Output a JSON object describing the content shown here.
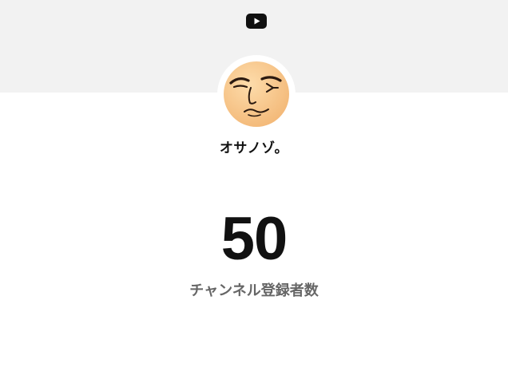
{
  "channel": {
    "name": "オサノゾ。",
    "avatar_icon": "smirking-face-avatar"
  },
  "header": {
    "logo_icon": "youtube-icon"
  },
  "subscribers": {
    "count": "50",
    "label": "チャンネル登録者数"
  },
  "colors": {
    "banner_bg": "#f2f2f2",
    "count_text": "#111111",
    "label_text": "#666666",
    "skin": "#f9cc96"
  }
}
